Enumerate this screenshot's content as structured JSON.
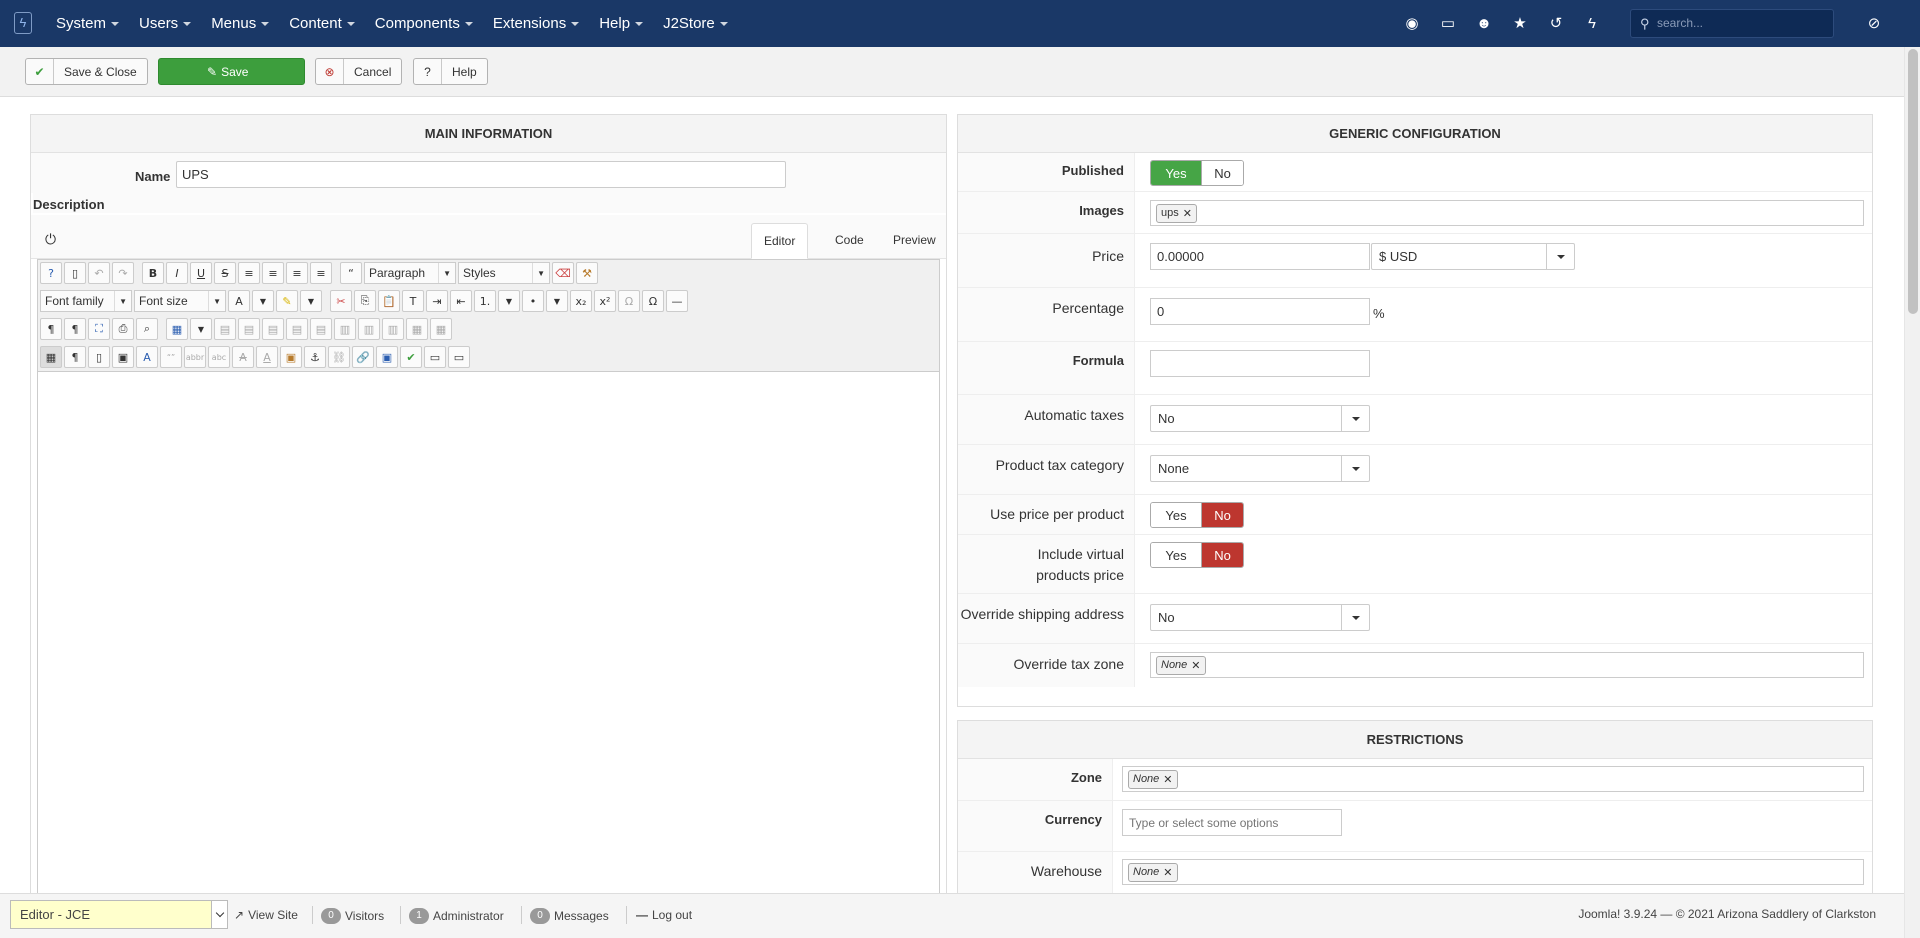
{
  "navbar": {
    "menu": [
      "System",
      "Users",
      "Menus",
      "Content",
      "Components",
      "Extensions",
      "Help",
      "J2Store"
    ],
    "icons": [
      "eye-icon",
      "desktop-icon",
      "user-icon",
      "star-icon",
      "history-icon",
      "bolt-icon"
    ],
    "search_placeholder": "search..."
  },
  "toolbar": {
    "save_close": "Save & Close",
    "save": "Save",
    "cancel": "Cancel",
    "help": "Help"
  },
  "main_info": {
    "heading": "MAIN INFORMATION",
    "name_label": "Name",
    "name_value": "UPS",
    "description_label": "Description",
    "tabs": [
      "Editor",
      "Code",
      "Preview"
    ],
    "active_tab": "Editor",
    "format_select": "Paragraph",
    "styles_select": "Styles",
    "font_family": "Font family",
    "font_size": "Font size"
  },
  "generic": {
    "heading": "GENERIC CONFIGURATION",
    "published_label": "Published",
    "published_yes": "Yes",
    "published_no": "No",
    "images_label": "Images",
    "images_chip": "ups",
    "price_label": "Price",
    "price_value": "0.00000",
    "currency": "$ USD",
    "percentage_label": "Percentage",
    "percentage_value": "0",
    "percent_sign": "%",
    "formula_label": "Formula",
    "formula_value": "",
    "auto_taxes_label": "Automatic taxes",
    "auto_taxes_value": "No",
    "tax_category_label": "Product tax category",
    "tax_category_value": "None",
    "price_per_product_label": "Use price per product",
    "price_per_product_yes": "Yes",
    "price_per_product_no": "No",
    "include_virtual_label_1": "Include virtual",
    "include_virtual_label_2": "products price",
    "include_virtual_yes": "Yes",
    "include_virtual_no": "No",
    "override_shipping_label": "Override shipping address",
    "override_shipping_value": "No",
    "override_tax_label": "Override tax zone",
    "override_tax_chip": "None"
  },
  "restrictions": {
    "heading": "RESTRICTIONS",
    "zone_label": "Zone",
    "zone_chip": "None",
    "currency_label": "Currency",
    "currency_placeholder": "Type or select some options",
    "warehouse_label": "Warehouse",
    "warehouse_chip": "None"
  },
  "statusbar": {
    "editor": "Editor - JCE",
    "view_site": "View Site",
    "visitors_count": "0",
    "visitors": "Visitors",
    "admin_count": "1",
    "admin": "Administrator",
    "messages_count": "0",
    "messages": "Messages",
    "logout": "Log out",
    "copyright": "Joomla! 3.9.24 — © 2021 Arizona Saddlery of Clarkston"
  },
  "colors": {
    "navbar": "#1a3867",
    "save_green": "#3d9e3d",
    "yes_green": "#46a546",
    "no_red": "#bd362f"
  }
}
